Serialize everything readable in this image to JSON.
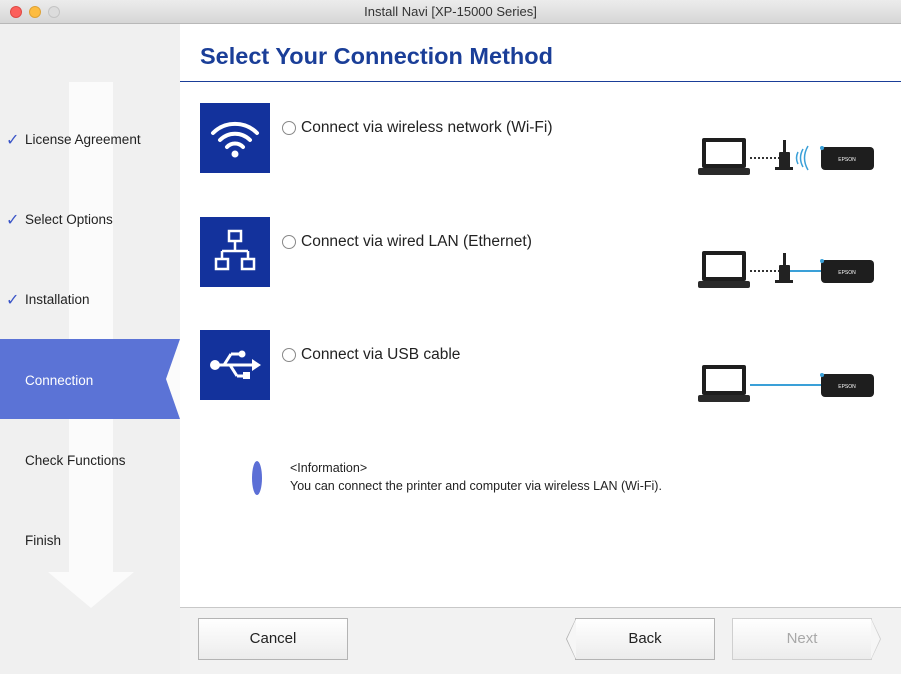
{
  "window": {
    "title": "Install Navi [XP-15000 Series]"
  },
  "sidebar": {
    "steps": [
      {
        "label": "License Agreement",
        "completed": true
      },
      {
        "label": "Select Options",
        "completed": true
      },
      {
        "label": "Installation",
        "completed": true
      },
      {
        "label": "Connection",
        "active": true
      },
      {
        "label": "Check Functions"
      },
      {
        "label": "Finish"
      }
    ],
    "check_glyph": "✓"
  },
  "main": {
    "title": "Select Your Connection Method",
    "options": [
      {
        "label": "Connect via wireless network (Wi-Fi)",
        "icon": "wifi-icon",
        "illustration": "laptop-router-wifi-printer"
      },
      {
        "label": "Connect via wired LAN (Ethernet)",
        "icon": "network-icon",
        "illustration": "laptop-router-cable-printer"
      },
      {
        "label": "Connect via USB cable",
        "icon": "usb-icon",
        "illustration": "laptop-usb-printer"
      }
    ],
    "printer_brand": "EPSON",
    "info": {
      "title": "<Information>",
      "text": "You can connect the printer and computer via wireless LAN (Wi-Fi)."
    }
  },
  "footer": {
    "cancel": "Cancel",
    "back": "Back",
    "next": "Next"
  },
  "colors": {
    "accent": "#13329c",
    "sidebar_active": "#5b73d6",
    "heading": "#1a3e98",
    "cable": "#3aa0d8"
  }
}
